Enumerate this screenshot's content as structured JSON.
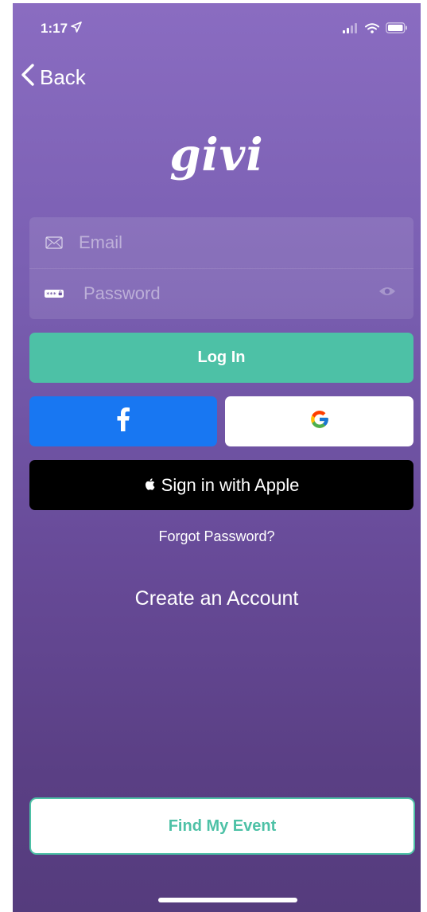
{
  "status_bar": {
    "time": "1:17",
    "icons": [
      "location-arrow-icon",
      "cellular-signal-icon",
      "wifi-icon",
      "battery-icon"
    ]
  },
  "nav": {
    "back_label": "Back",
    "back_icon": "chevron-left-icon"
  },
  "app": {
    "logo_text": "givi"
  },
  "form": {
    "email": {
      "placeholder": "Email",
      "value": "",
      "icon": "envelope-icon"
    },
    "password": {
      "placeholder": "Password",
      "value": "",
      "icon": "password-dots-icon",
      "toggle_icon": "eye-icon"
    }
  },
  "buttons": {
    "login_label": "Log In",
    "facebook_icon": "facebook-icon",
    "google_icon": "google-icon",
    "apple_label": "Sign in with Apple",
    "apple_icon": "apple-icon",
    "forgot_label": "Forgot Password?",
    "create_label": "Create an Account",
    "find_event_label": "Find My Event"
  },
  "colors": {
    "background_top": "#8a6cc1",
    "background_bottom": "#553c7d",
    "accent_green": "#4dc1a6",
    "facebook_blue": "#1877f2",
    "apple_black": "#000000"
  }
}
